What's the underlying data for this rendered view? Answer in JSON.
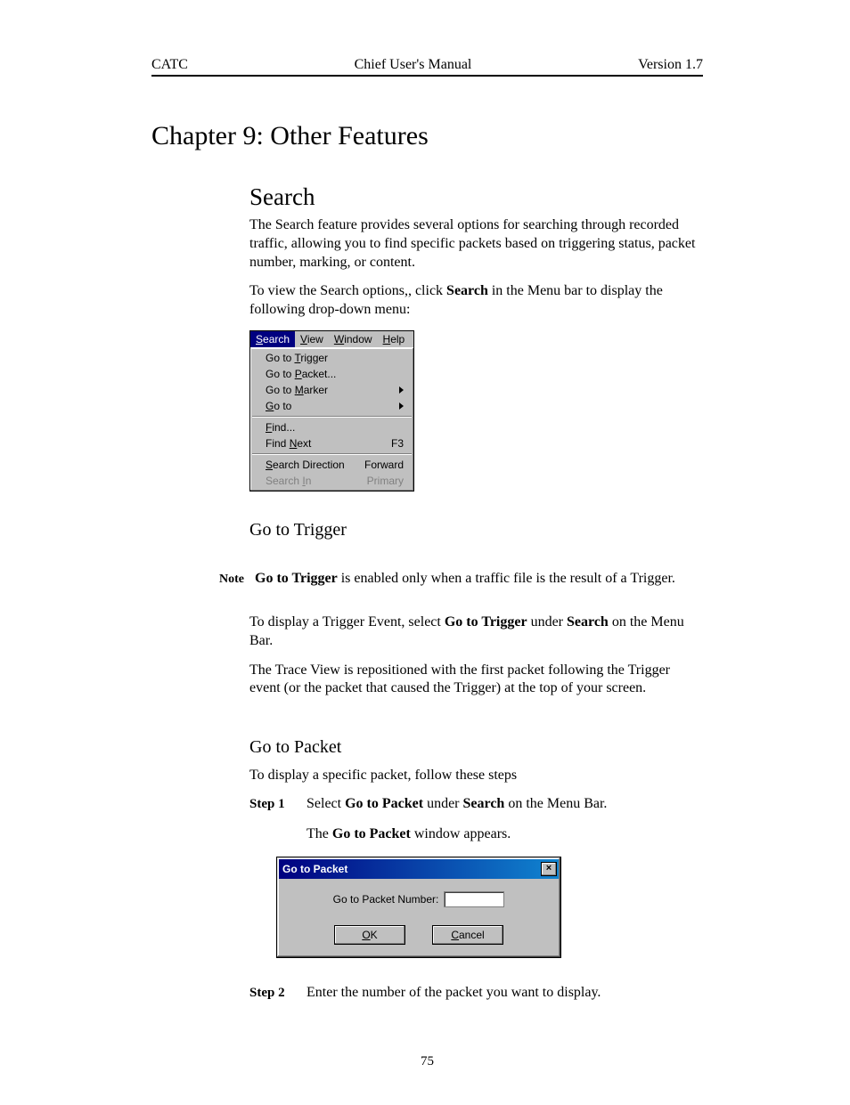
{
  "header": {
    "left": "CATC",
    "center": "Chief User's Manual",
    "right": "Version 1.7"
  },
  "chapter_title": "Chapter 9: Other Features",
  "search": {
    "heading": "Search",
    "p1": "The Search feature provides several options for searching through recorded traffic, allowing you to find specific packets based on triggering status, packet number, marking, or content.",
    "p2_a": "To view the Search options,, click ",
    "p2_b": "Search",
    "p2_c": " in the Menu bar to display the following drop-down menu:"
  },
  "menu": {
    "menubar": {
      "search": "Search",
      "view": "View",
      "window": "Window",
      "help": "Help"
    },
    "items": {
      "goto_trigger": "Go to Trigger",
      "goto_packet": "Go to Packet...",
      "goto_marker": "Go to Marker",
      "goto": "Go to",
      "find": "Find...",
      "find_next": "Find Next",
      "find_next_key": "F3",
      "search_dir": "Search Direction",
      "search_dir_val": "Forward",
      "search_in": "Search In",
      "search_in_val": "Primary"
    }
  },
  "gototrigger": {
    "heading": "Go to Trigger",
    "note_label": "Note",
    "note_a": "Go to Trigger",
    "note_b": " is enabled only when a traffic file is the result of a Trigger.",
    "p1_a": "To display a Trigger Event, select ",
    "p1_b": "Go to Trigger",
    "p1_c": " under ",
    "p1_d": "Search",
    "p1_e": " on the Menu Bar.",
    "p2": "The Trace View is repositioned with the first packet following the Trigger event (or the packet that caused the Trigger) at the top of your screen."
  },
  "gotopacket": {
    "heading": "Go to Packet",
    "intro": "To display a specific packet, follow these steps",
    "step1_label": "Step 1",
    "step1_a": "Select ",
    "step1_b": "Go to Packet",
    "step1_c": " under ",
    "step1_d": "Search",
    "step1_e": " on the Menu Bar.",
    "step1_f_a": "The ",
    "step1_f_b": "Go to Packet",
    "step1_f_c": " window appears.",
    "step2_label": "Step 2",
    "step2_text": "Enter the number of the packet you want to display."
  },
  "dialog": {
    "title": "Go to Packet",
    "close": "×",
    "label": "Go to Packet Number:",
    "input_value": "",
    "ok": "OK",
    "cancel": "Cancel"
  },
  "page_number": "75"
}
